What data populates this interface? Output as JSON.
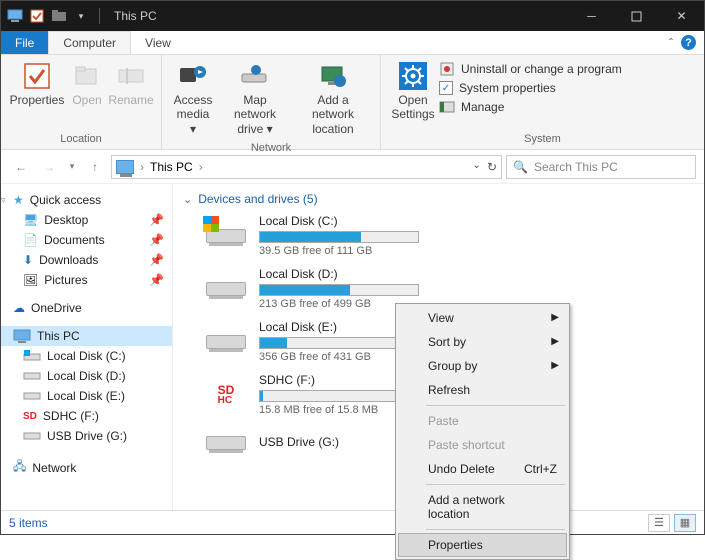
{
  "window": {
    "title": "This PC"
  },
  "menu": {
    "file": "File",
    "tabs": [
      "Computer",
      "View"
    ],
    "activeIndex": 0
  },
  "ribbon": {
    "groups": [
      {
        "label": "Location",
        "buttons": [
          {
            "label": "Properties",
            "disabled": false
          },
          {
            "label": "Open",
            "disabled": true
          },
          {
            "label": "Rename",
            "disabled": true
          }
        ]
      },
      {
        "label": "Network",
        "buttons": [
          {
            "label": "Access media",
            "dropdown": true
          },
          {
            "label": "Map network drive",
            "dropdown": true
          },
          {
            "label": "Add a network location"
          }
        ]
      },
      {
        "label": "System",
        "bigButton": {
          "label": "Open Settings"
        },
        "options": [
          {
            "label": "Uninstall or change a program"
          },
          {
            "label": "System properties"
          },
          {
            "label": "Manage"
          }
        ]
      }
    ]
  },
  "address": {
    "path": "This PC",
    "searchPlaceholder": "Search This PC"
  },
  "nav": {
    "quickAccess": {
      "label": "Quick access"
    },
    "quickItems": [
      {
        "label": "Desktop",
        "pinned": true
      },
      {
        "label": "Documents",
        "pinned": true
      },
      {
        "label": "Downloads",
        "pinned": true
      },
      {
        "label": "Pictures",
        "pinned": true
      }
    ],
    "oneDrive": {
      "label": "OneDrive"
    },
    "thisPC": {
      "label": "This PC"
    },
    "pcItems": [
      {
        "label": "Local Disk (C:)"
      },
      {
        "label": "Local Disk (D:)"
      },
      {
        "label": "Local Disk (E:)"
      },
      {
        "label": "SDHC (F:)"
      },
      {
        "label": "USB Drive (G:)"
      }
    ],
    "network": {
      "label": "Network"
    }
  },
  "section": {
    "header": "Devices and drives (5)"
  },
  "drives": [
    {
      "name": "Local Disk (C:)",
      "free": "39.5 GB free of 111 GB",
      "fillPct": 64,
      "icon": "win"
    },
    {
      "name": "Local Disk (D:)",
      "free": "213 GB free of 499 GB",
      "fillPct": 57,
      "icon": "hdd"
    },
    {
      "name": "Local Disk (E:)",
      "free": "356 GB free of 431 GB",
      "fillPct": 17,
      "icon": "hdd"
    },
    {
      "name": "SDHC (F:)",
      "free": "15.8 MB free of 15.8 MB",
      "fillPct": 2,
      "icon": "sdhc"
    },
    {
      "name": "USB Drive (G:)",
      "free": "",
      "fillPct": null,
      "icon": "usb"
    }
  ],
  "contextMenu": {
    "items": [
      {
        "label": "View",
        "submenu": true
      },
      {
        "label": "Sort by",
        "submenu": true
      },
      {
        "label": "Group by",
        "submenu": true
      },
      {
        "label": "Refresh"
      },
      {
        "sep": true
      },
      {
        "label": "Paste",
        "disabled": true
      },
      {
        "label": "Paste shortcut",
        "disabled": true
      },
      {
        "label": "Undo Delete",
        "shortcut": "Ctrl+Z"
      },
      {
        "sep": true
      },
      {
        "label": "Add a network location"
      },
      {
        "sep": true
      },
      {
        "label": "Properties",
        "hover": true
      }
    ]
  },
  "status": {
    "text": "5 items"
  }
}
